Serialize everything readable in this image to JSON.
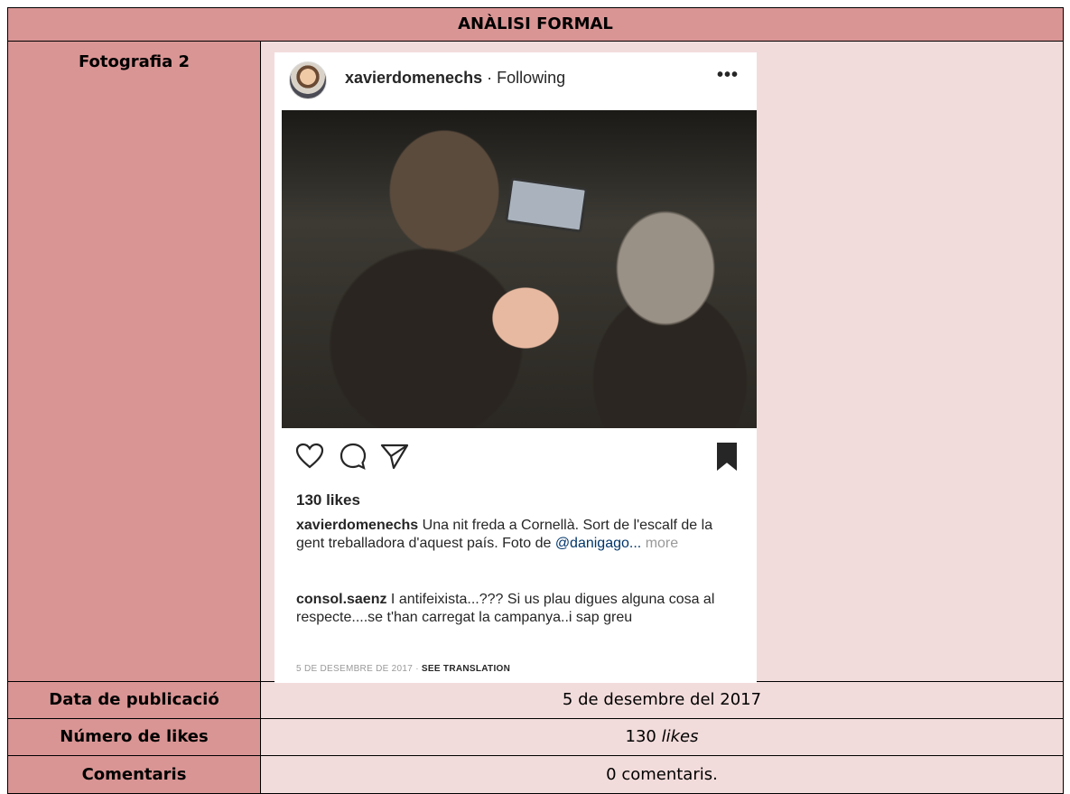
{
  "header": {
    "title": "ANÀLISI FORMAL"
  },
  "rows": {
    "photo_label": "Fotografia 2",
    "date_label": "Data de publicació",
    "date_value": "5 de desembre del 2017",
    "likes_label": "Número de likes",
    "likes_number": "130",
    "likes_word": "likes",
    "comments_label": "Comentaris",
    "comments_value": "0 comentaris."
  },
  "post": {
    "account": "xavierdomenechs",
    "follow_state": "Following",
    "more_label": "•••",
    "likes_text": "130 likes",
    "caption_user": "xavierdomenechs",
    "caption_text": " Una nit freda a Cornellà. Sort de l'escalf de la gent treballadora d'aquest país. Foto de ",
    "caption_mention": "@danigago",
    "caption_ellipsis": "...",
    "caption_more": " more",
    "comment_user": "consol.saenz",
    "comment_text": " I antifeixista...??? Si us plau digues alguna cosa al respecte....se t'han carregat la campanya..i sap greu",
    "date_text": "5 DE DESEMBRE DE 2017 · ",
    "translation_link": "SEE TRANSLATION",
    "icons": [
      "heart-icon",
      "comment-icon",
      "share-icon",
      "bookmark-icon"
    ]
  },
  "colors": {
    "label_bg": "#d99594",
    "value_bg": "#f2dcdb"
  }
}
